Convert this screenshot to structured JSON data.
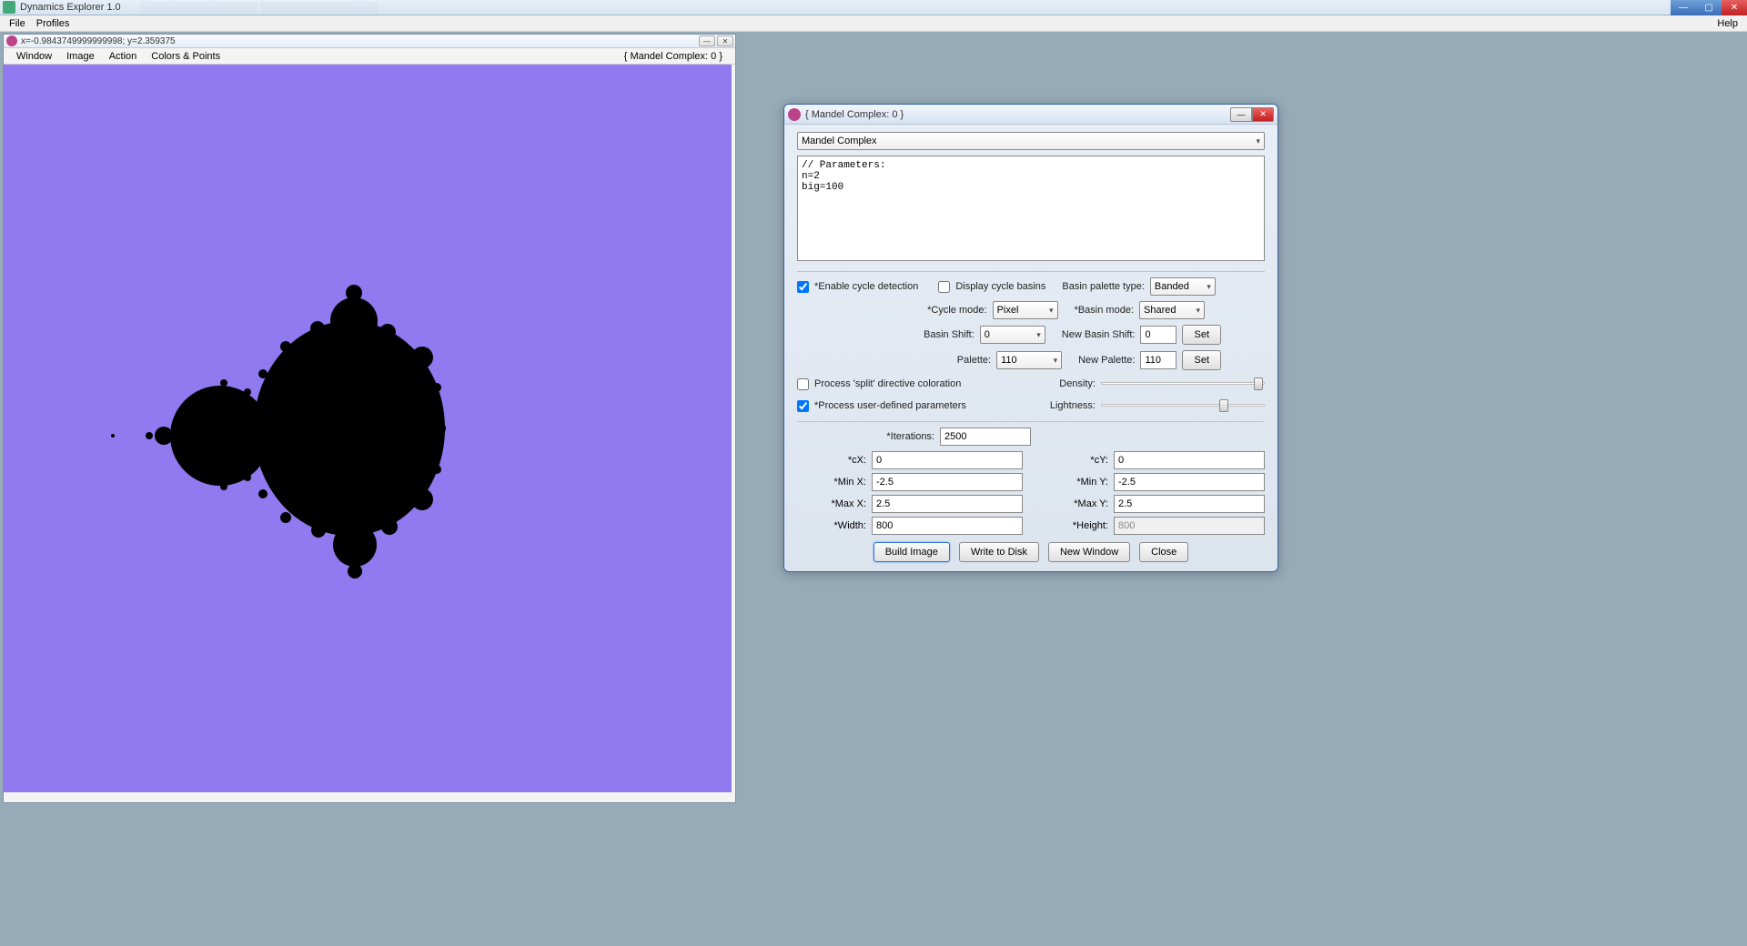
{
  "app": {
    "title": "Dynamics Explorer 1.0"
  },
  "menu": {
    "file": "File",
    "profiles": "Profiles",
    "help": "Help"
  },
  "fractalWindow": {
    "coords": "x=-0.9843749999999998; y=2.359375",
    "name": "{ Mandel Complex: 0 }",
    "menus": {
      "window": "Window",
      "image": "Image",
      "action": "Action",
      "colors": "Colors & Points"
    }
  },
  "dialog": {
    "title": "{ Mandel Complex: 0 }",
    "system_select": "Mandel Complex",
    "params_text": "// Parameters:\nn=2\nbig=100",
    "cycle": {
      "enable_label": "*Enable cycle detection",
      "enable_checked": true,
      "display_label": "Display cycle basins",
      "display_checked": false,
      "basin_palette_label": "Basin palette type:",
      "basin_palette_value": "Banded",
      "cycle_mode_label": "*Cycle mode:",
      "cycle_mode_value": "Pixel",
      "basin_mode_label": "*Basin mode:",
      "basin_mode_value": "Shared",
      "basin_shift_label": "Basin Shift:",
      "basin_shift_value": "0",
      "new_basin_shift_label": "New Basin Shift:",
      "new_basin_shift_value": "0",
      "palette_label": "Palette:",
      "palette_value": "110",
      "new_palette_label": "New Palette:",
      "new_palette_value": "110",
      "set_label": "Set",
      "split_label": "Process 'split' directive coloration",
      "split_checked": false,
      "density_label": "Density:",
      "userparams_label": "*Process user-defined parameters",
      "userparams_checked": true,
      "lightness_label": "Lightness:"
    },
    "bounds": {
      "iterations_label": "*Iterations:",
      "iterations_value": "2500",
      "cx_label": "*cX:",
      "cx_value": "0",
      "cy_label": "*cY:",
      "cy_value": "0",
      "minx_label": "*Min X:",
      "minx_value": "-2.5",
      "miny_label": "*Min Y:",
      "miny_value": "-2.5",
      "maxx_label": "*Max X:",
      "maxx_value": "2.5",
      "maxy_label": "*Max Y:",
      "maxy_value": "2.5",
      "width_label": "*Width:",
      "width_value": "800",
      "height_label": "*Height:",
      "height_value": "800"
    },
    "buttons": {
      "build": "Build Image",
      "write": "Write to Disk",
      "neww": "New Window",
      "close": "Close"
    }
  }
}
